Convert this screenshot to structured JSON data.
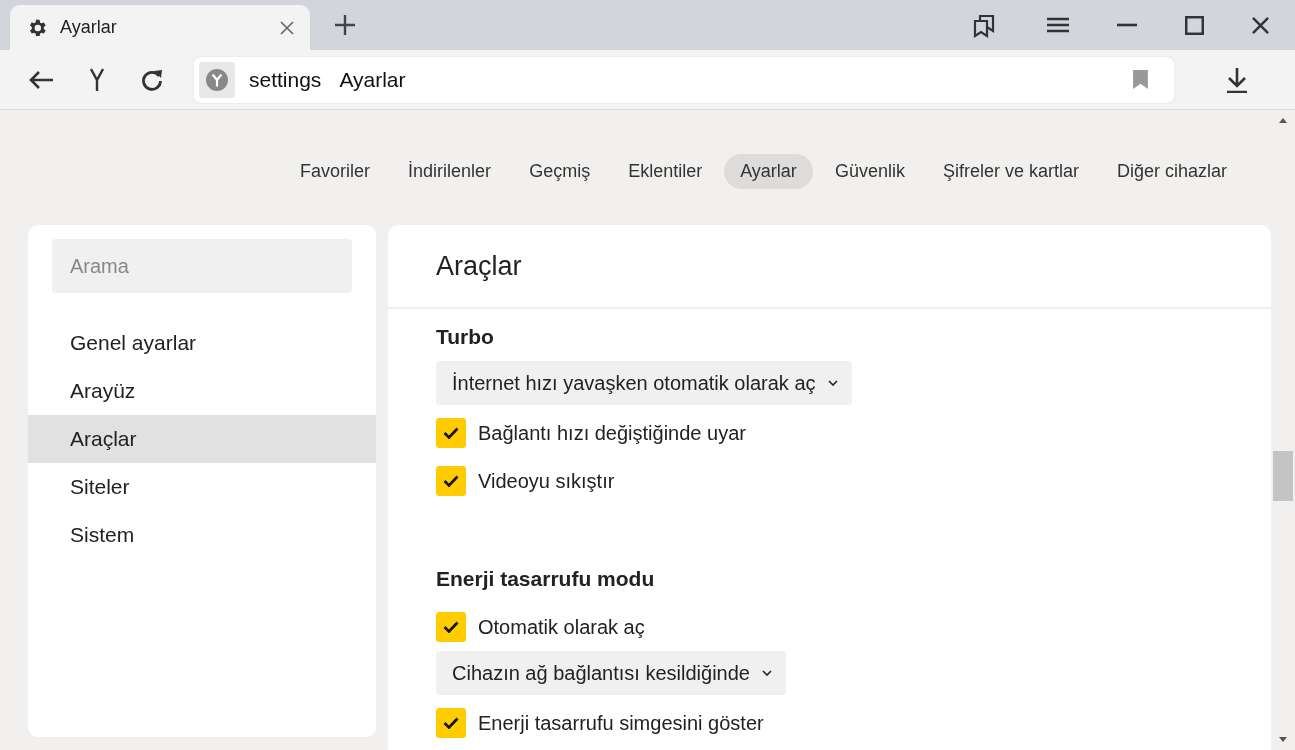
{
  "tab": {
    "title": "Ayarlar"
  },
  "address_bar": {
    "host": "settings",
    "title": "Ayarlar"
  },
  "nav_tabs": [
    {
      "label": "Favoriler",
      "selected": false
    },
    {
      "label": "İndirilenler",
      "selected": false
    },
    {
      "label": "Geçmiş",
      "selected": false
    },
    {
      "label": "Eklentiler",
      "selected": false
    },
    {
      "label": "Ayarlar",
      "selected": true
    },
    {
      "label": "Güvenlik",
      "selected": false
    },
    {
      "label": "Şifreler ve kartlar",
      "selected": false
    },
    {
      "label": "Diğer cihazlar",
      "selected": false
    }
  ],
  "sidebar": {
    "search": {
      "placeholder": "Arama"
    },
    "items": [
      {
        "label": "Genel ayarlar",
        "selected": false
      },
      {
        "label": "Arayüz",
        "selected": false
      },
      {
        "label": "Araçlar",
        "selected": true
      },
      {
        "label": "Siteler",
        "selected": false
      },
      {
        "label": "Sistem",
        "selected": false
      }
    ]
  },
  "content": {
    "title": "Araçlar",
    "sections": [
      {
        "title": "Turbo",
        "items": [
          {
            "kind": "select",
            "label": "İnternet hızı yavaşken otomatik olarak aç"
          },
          {
            "kind": "checkbox",
            "label": "Bağlantı hızı değiştiğinde uyar",
            "checked": true
          },
          {
            "kind": "checkbox",
            "label": "Videoyu sıkıştır",
            "checked": true
          }
        ]
      },
      {
        "title": "Enerji tasarrufu modu",
        "items": [
          {
            "kind": "checkbox",
            "label": "Otomatik olarak aç",
            "checked": true
          },
          {
            "kind": "select",
            "label": "Cihazın ağ bağlantısı kesildiğinde"
          },
          {
            "kind": "checkbox",
            "label": "Enerji tasarrufu simgesini göster",
            "checked": true
          }
        ]
      }
    ]
  }
}
